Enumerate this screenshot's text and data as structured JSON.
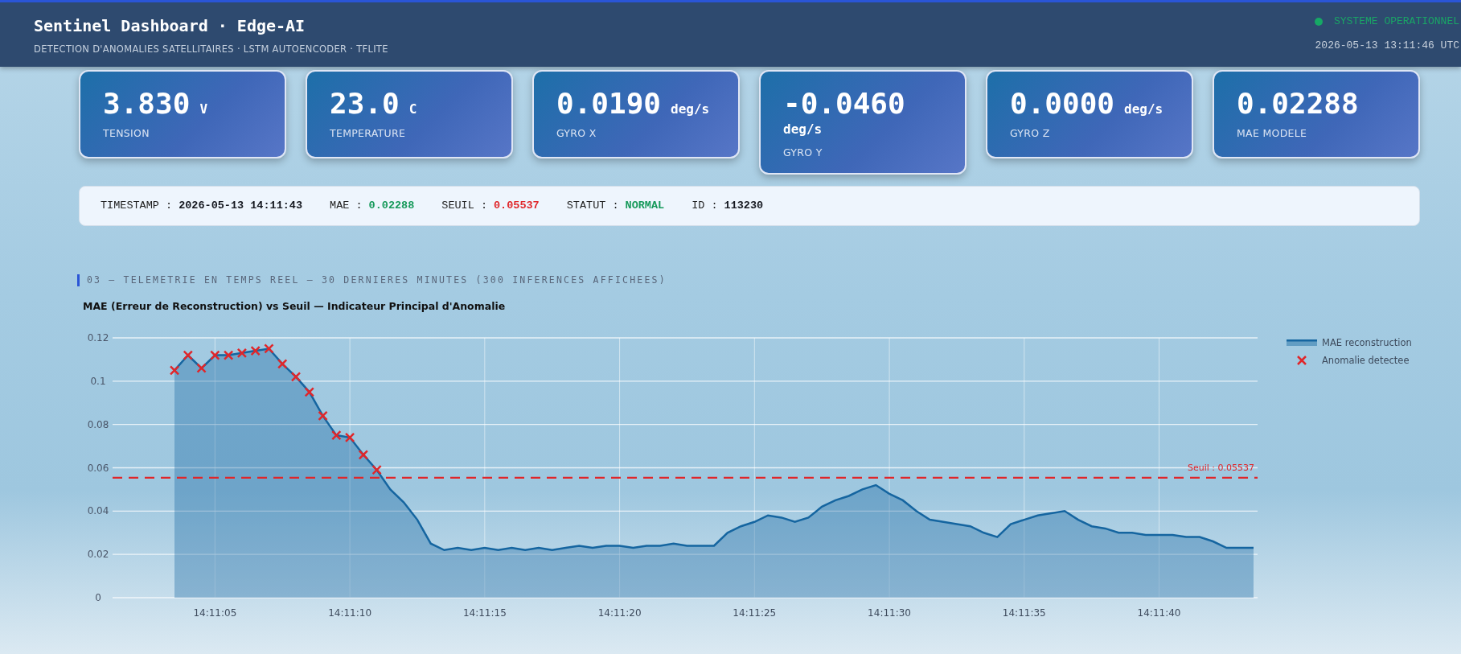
{
  "header": {
    "title": "Sentinel Dashboard · Edge-AI",
    "subtitle": "DETECTION D'ANOMALIES SATELLITAIRES · LSTM AUTOENCODER · TFLITE",
    "status": "SYSTEME OPERATIONNEL",
    "datetime": "2026-05-13 13:11:46 UTC"
  },
  "metrics": [
    {
      "value": "3.830",
      "unit": "V",
      "label": "TENSION"
    },
    {
      "value": "23.0",
      "unit": "C",
      "label": "TEMPERATURE"
    },
    {
      "value": "0.0190",
      "unit": "deg/s",
      "label": "GYRO X"
    },
    {
      "value": "-0.0460",
      "unit": "deg/s",
      "label": "GYRO Y"
    },
    {
      "value": "0.0000",
      "unit": "deg/s",
      "label": "GYRO Z"
    },
    {
      "value": "0.02288",
      "label": "MAE MODELE"
    }
  ],
  "info_bar": [
    {
      "label": "TIMESTAMP :",
      "value": "2026-05-13 14:11:43",
      "color": "#14171f"
    },
    {
      "label": "MAE :",
      "value": "0.02288",
      "color": "#179a5b"
    },
    {
      "label": "SEUIL :",
      "value": "0.05537",
      "color": "#e0262a"
    },
    {
      "label": "STATUT :",
      "value": "NORMAL",
      "color": "#179a5b"
    },
    {
      "label": "ID :",
      "value": "113230",
      "color": "#14171f"
    }
  ],
  "section_title": "03 — TELEMETRIE EN TEMPS REEL — 30 DERNIERES MINUTES (300 INFERENCES AFFICHEES)",
  "chart": {
    "chart_data": {
      "type": "area",
      "grid": true,
      "legend": true,
      "title": "MAE (Erreur de Reconstruction) vs Seuil — Indicateur Principal d'Anomalie",
      "categories": [
        null,
        null,
        null,
        "14:11:05",
        null,
        null,
        null,
        null,
        null,
        null,
        null,
        null,
        null,
        "14:11:10",
        null,
        null,
        null,
        null,
        null,
        null,
        null,
        null,
        null,
        "14:11:15",
        null,
        null,
        null,
        null,
        null,
        null,
        null,
        null,
        null,
        "14:11:20",
        null,
        null,
        null,
        null,
        null,
        null,
        null,
        null,
        null,
        "14:11:25",
        null,
        null,
        null,
        null,
        null,
        null,
        null,
        null,
        null,
        "14:11:30",
        null,
        null,
        null,
        null,
        null,
        null,
        null,
        null,
        null,
        "14:11:35",
        null,
        null,
        null,
        null,
        null,
        null,
        null,
        null,
        null,
        "14:11:40",
        null,
        null,
        null,
        null,
        null,
        null,
        null
      ],
      "series": [
        {
          "name": "MAE reconstruction",
          "color": "#1565a0",
          "values": [
            0.105,
            0.112,
            0.106,
            0.112,
            0.112,
            0.113,
            0.114,
            0.115,
            0.108,
            0.102,
            0.095,
            0.084,
            0.075,
            0.074,
            0.066,
            0.059,
            0.05,
            0.044,
            0.036,
            0.025,
            0.022,
            0.023,
            0.022,
            0.023,
            0.022,
            0.023,
            0.022,
            0.023,
            0.022,
            0.023,
            0.024,
            0.023,
            0.024,
            0.024,
            0.023,
            0.024,
            0.024,
            0.025,
            0.024,
            0.024,
            0.024,
            0.03,
            0.033,
            0.035,
            0.038,
            0.037,
            0.035,
            0.037,
            0.042,
            0.045,
            0.047,
            0.05,
            0.052,
            0.048,
            0.045,
            0.04,
            0.036,
            0.035,
            0.034,
            0.033,
            0.03,
            0.028,
            0.034,
            0.036,
            0.038,
            0.039,
            0.04,
            0.036,
            0.033,
            0.032,
            0.03,
            0.03,
            0.029,
            0.029,
            0.029,
            0.028,
            0.028,
            0.026,
            0.023,
            0.023,
            0.023
          ]
        },
        {
          "name": "Anomalie detectee",
          "color": "#e0262a",
          "type": "scatter",
          "marker": "cross",
          "values": [
            0.105,
            0.112,
            0.106,
            0.112,
            0.112,
            0.113,
            0.114,
            0.115,
            0.108,
            0.102,
            0.095,
            0.084,
            0.075,
            0.074,
            0.066,
            0.059,
            null,
            null,
            null,
            null,
            null,
            null,
            null,
            null,
            null,
            null,
            null,
            null,
            null,
            null,
            null,
            null,
            null,
            null,
            null,
            null,
            null,
            null,
            null,
            null,
            null,
            null,
            null,
            null,
            null,
            null,
            null,
            null,
            null,
            null,
            null,
            null,
            null,
            null,
            null,
            null,
            null,
            null,
            null,
            null,
            null,
            null,
            null,
            null,
            null,
            null,
            null,
            null,
            null,
            null,
            null,
            null,
            null,
            null,
            null,
            null,
            null,
            null,
            null,
            null,
            null
          ]
        }
      ],
      "ylim": [
        0,
        0.12
      ],
      "yticks": [
        {
          "value": 0,
          "label": "0"
        },
        {
          "value": 0.02,
          "label": "0.02"
        },
        {
          "value": 0.04,
          "label": "0.04"
        },
        {
          "value": 0.06,
          "label": "0.06"
        },
        {
          "value": 0.08,
          "label": "0.08"
        },
        {
          "value": 0.1,
          "label": "0.1"
        },
        {
          "value": 0.12,
          "label": "0.12"
        }
      ],
      "ref_lines": [
        {
          "axis": "y",
          "value": 0.05537,
          "label": "Seuil : 0.05537",
          "color": "#e0262a"
        }
      ]
    }
  }
}
